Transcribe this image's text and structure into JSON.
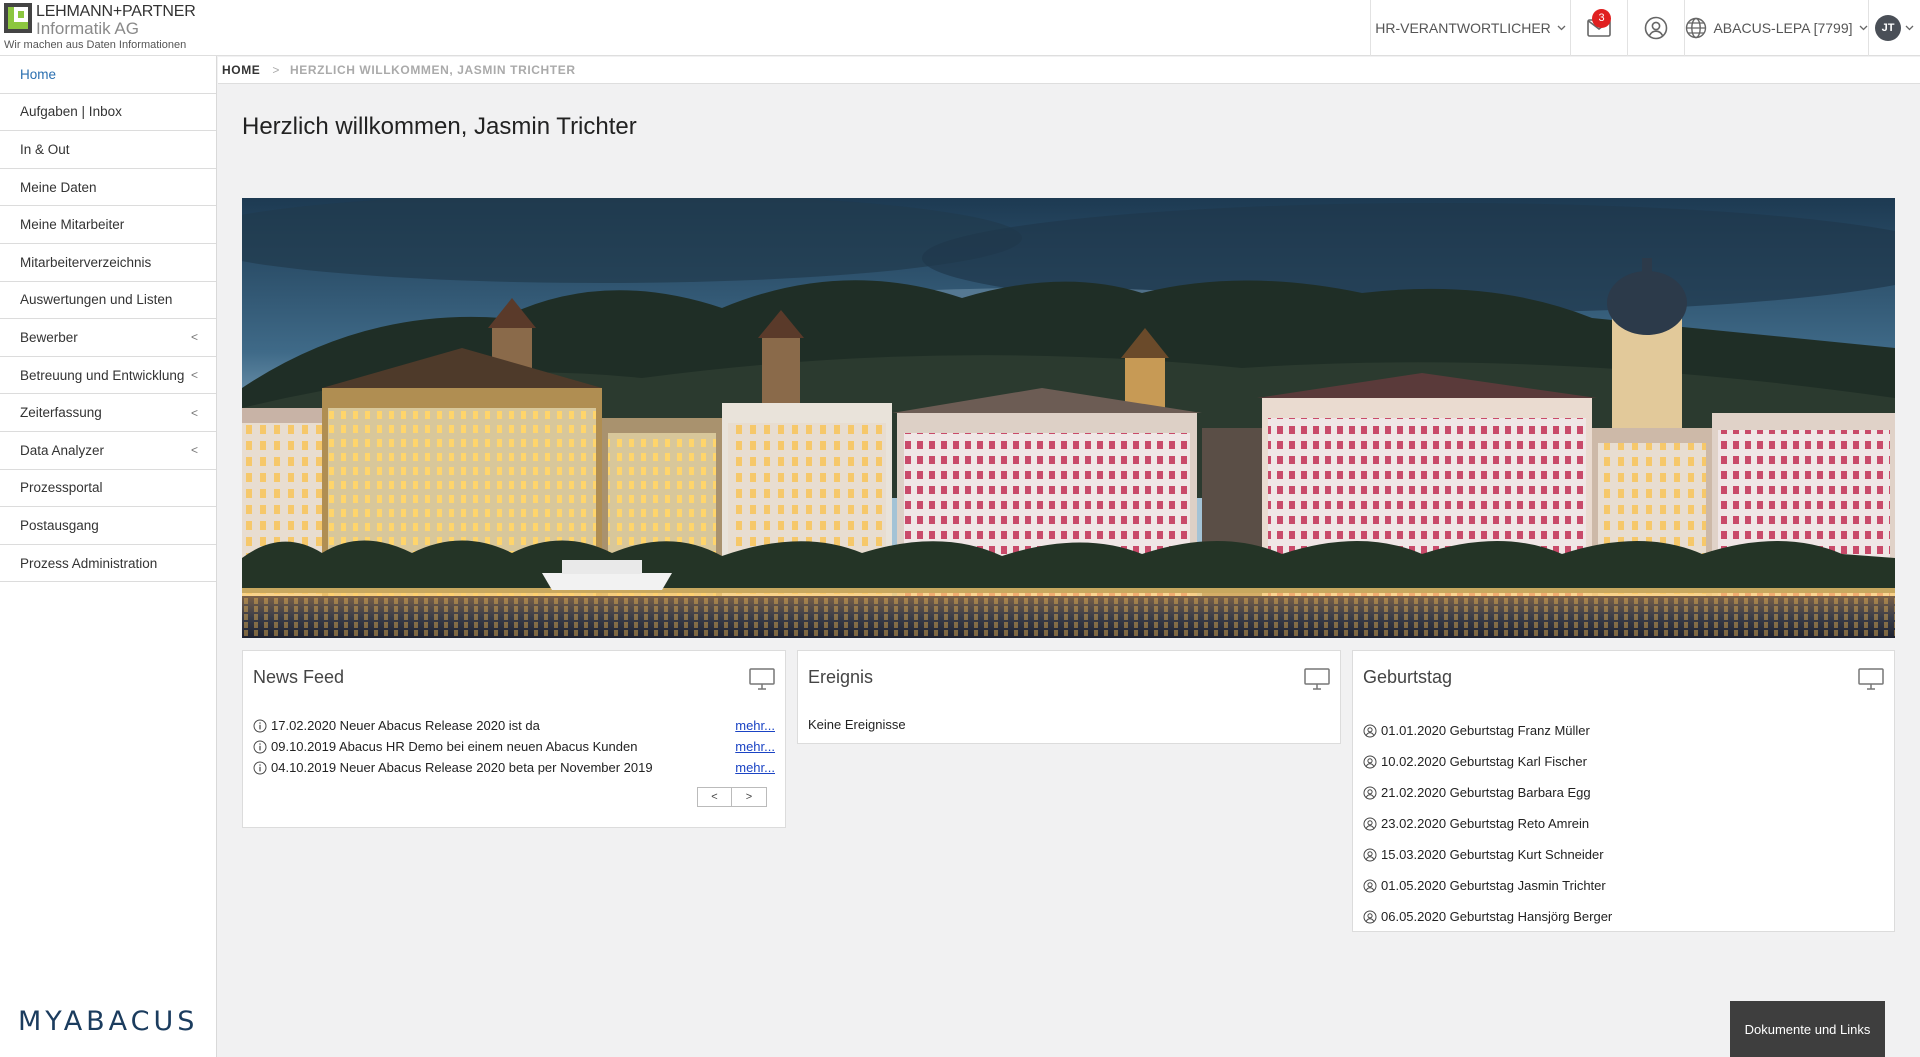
{
  "logo": {
    "title": "LEHMANN+PARTNER",
    "subtitle": "Informatik AG",
    "slogan": "Wir machen aus Daten Informationen"
  },
  "header": {
    "role_label": "HR-VERANTWORTLICHER",
    "mail_count": "3",
    "mandant_label": "ABACUS-LEPA [7799]",
    "avatar_initials": "JT"
  },
  "sidebar": {
    "items": [
      {
        "label": "Home",
        "active": true,
        "submenu": false
      },
      {
        "label": "Aufgaben | Inbox",
        "submenu": false
      },
      {
        "label": "In & Out",
        "submenu": false
      },
      {
        "label": "Meine Daten",
        "submenu": false
      },
      {
        "label": "Meine Mitarbeiter",
        "submenu": false
      },
      {
        "label": "Mitarbeiterverzeichnis",
        "submenu": false
      },
      {
        "label": "Auswertungen und Listen",
        "submenu": false
      },
      {
        "label": "Bewerber",
        "submenu": true
      },
      {
        "label": "Betreuung und Entwicklung",
        "submenu": true
      },
      {
        "label": "Zeiterfassung",
        "submenu": true
      },
      {
        "label": "Data Analyzer",
        "submenu": true
      },
      {
        "label": "Prozessportal",
        "submenu": false
      },
      {
        "label": "Postausgang",
        "submenu": false
      },
      {
        "label": "Prozess Administration",
        "submenu": false
      }
    ],
    "brand": "MYABACUS",
    "submenu_arrow": "<"
  },
  "breadcrumb": {
    "home": "HOME",
    "separator": ">",
    "current": "HERZLICH WILLKOMMEN, JASMIN TRICHTER"
  },
  "page_title": "Herzlich willkommen, Jasmin Trichter",
  "news_feed": {
    "title": "News Feed",
    "items": [
      {
        "text": "17.02.2020 Neuer Abacus Release 2020 ist da",
        "link": "mehr..."
      },
      {
        "text": "09.10.2019 Abacus HR Demo bei einem neuen Abacus Kunden",
        "link": "mehr..."
      },
      {
        "text": "04.10.2019 Neuer Abacus Release 2020 beta per November 2019",
        "link": "mehr..."
      }
    ],
    "prev": "<",
    "next": ">"
  },
  "ereignis": {
    "title": "Ereignis",
    "empty_text": "Keine Ereignisse"
  },
  "geburtstag": {
    "title": "Geburtstag",
    "items": [
      "01.01.2020 Geburtstag Franz Müller",
      "10.02.2020 Geburtstag Karl Fischer",
      "21.02.2020 Geburtstag Barbara Egg",
      "23.02.2020 Geburtstag Reto Amrein",
      "15.03.2020 Geburtstag Kurt Schneider",
      "01.05.2020 Geburtstag Jasmin Trichter",
      "06.05.2020 Geburtstag Hansjörg Berger"
    ]
  },
  "docs_button": "Dokumente und Links",
  "colors": {
    "accent_link": "#2a6fb0",
    "badge": "#e02020",
    "brand": "#1b3c5e",
    "logo_green": "#8cc63f"
  },
  "icons": {
    "mail": "mail-icon",
    "user": "user-circle-icon",
    "globe": "globe-icon",
    "monitor": "monitor-icon",
    "info": "info-icon",
    "person": "person-circle-icon"
  }
}
